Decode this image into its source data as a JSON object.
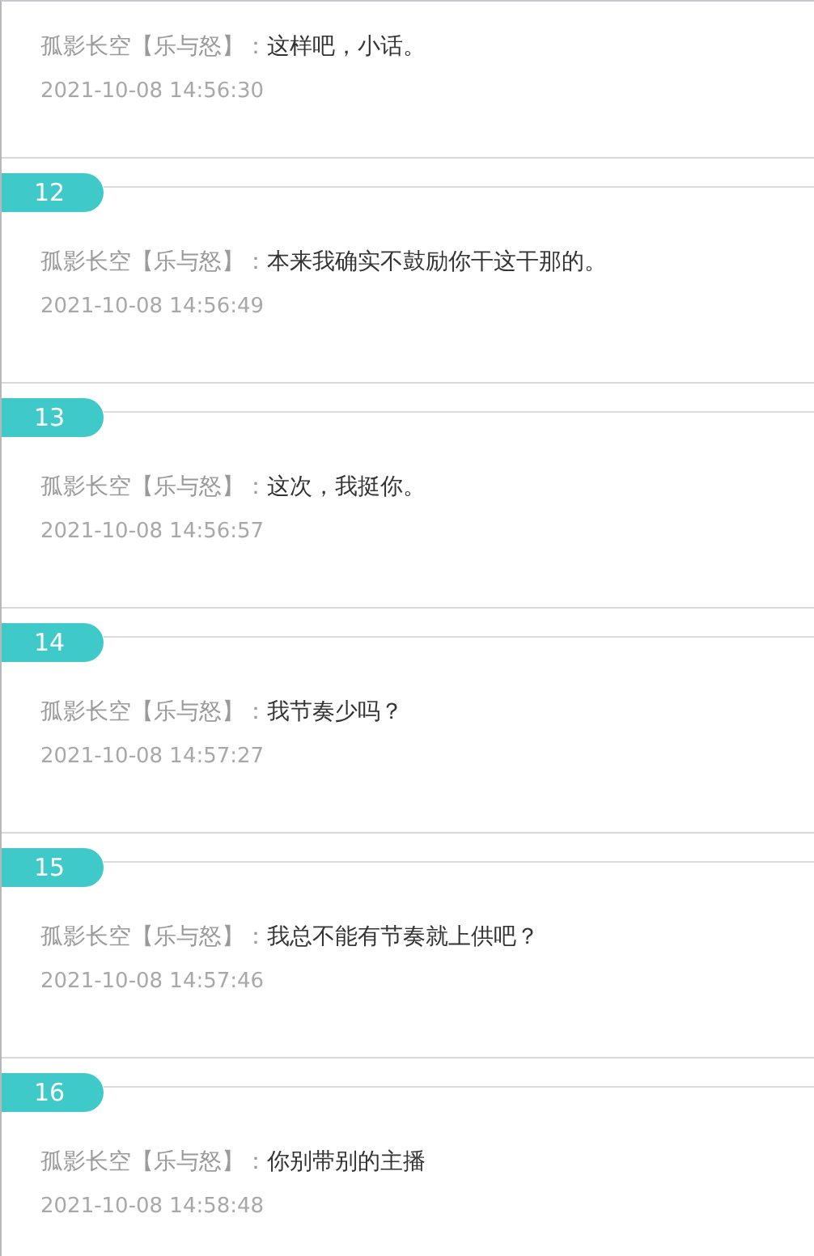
{
  "entries": [
    {
      "speaker": "孤影长空【乐与怒】：",
      "message": "这样吧，小话。",
      "time": "2021-10-08 14:56:30"
    },
    {
      "number": "12",
      "speaker": "孤影长空【乐与怒】：",
      "message": "本来我确实不鼓励你干这干那的。",
      "time": "2021-10-08 14:56:49"
    },
    {
      "number": "13",
      "speaker": "孤影长空【乐与怒】：",
      "message": "这次，我挺你。",
      "time": "2021-10-08 14:56:57"
    },
    {
      "number": "14",
      "speaker": "孤影长空【乐与怒】：",
      "message": "我节奏少吗？",
      "time": "2021-10-08 14:57:27"
    },
    {
      "number": "15",
      "speaker": "孤影长空【乐与怒】：",
      "message": "我总不能有节奏就上供吧？",
      "time": "2021-10-08 14:57:46"
    },
    {
      "number": "16",
      "speaker": "孤影长空【乐与怒】：",
      "message": "你别带别的主播",
      "time": "2021-10-08 14:58:48"
    }
  ]
}
